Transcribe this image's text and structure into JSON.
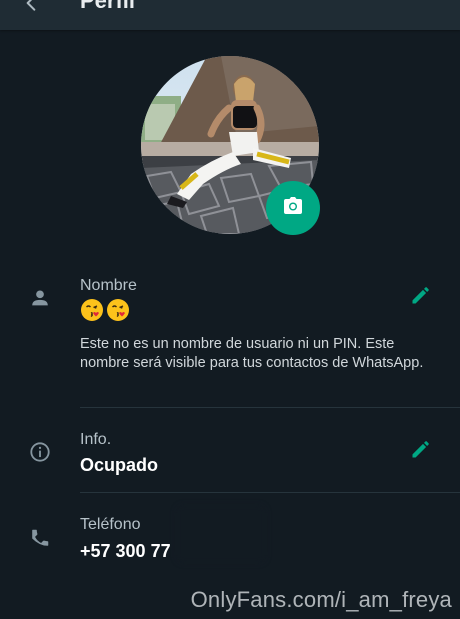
{
  "header": {
    "title": "Perfil",
    "back_icon": "arrow-left-icon"
  },
  "profile": {
    "photo_icon": "profile-photo",
    "camera_icon": "camera-icon"
  },
  "name_section": {
    "label": "Nombre",
    "value_emojis": [
      "face-blowing-kiss",
      "face-blowing-kiss"
    ],
    "hint": "Este no es un nombre de usuario ni un PIN. Este nombre será visible para tus contactos de WhatsApp.",
    "icon": "person-icon",
    "edit_icon": "pencil-icon"
  },
  "info_section": {
    "label": "Info.",
    "value": "Ocupado",
    "icon": "info-icon",
    "edit_icon": "pencil-icon"
  },
  "phone_section": {
    "label": "Teléfono",
    "value": "+57 300 77",
    "icon": "phone-icon"
  },
  "watermark": "OnlyFans.com/i_am_freya",
  "colors": {
    "background": "#121b22",
    "app_bar": "#1f2c34",
    "accent": "#00a884",
    "label": "#b6c2c9",
    "value": "#ffffff"
  }
}
